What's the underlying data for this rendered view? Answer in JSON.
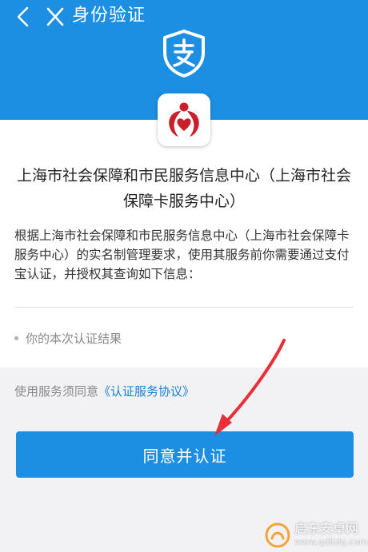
{
  "header": {
    "title": "身份验证",
    "back_icon": "chevron-left-icon",
    "close_icon": "close-icon",
    "badge_icon": "alipay-shield-icon",
    "background_color": "#1c8fe3"
  },
  "org": {
    "logo_icon": "heart-hands-logo",
    "name": "上海市社会保障和市民服务信息中心（上海市社会保障卡服务中心）",
    "description": "根据上海市社会保障和市民服务信息中心（上海市社会保障卡服务中心）的实名制管理要求，使用其服务前你需要通过支付宝认证，并授权其查询如下信息："
  },
  "permissions": [
    "你的本次认证结果"
  ],
  "agreement": {
    "prefix": "使用服务须同意",
    "link": "《认证服务协议》",
    "link_color": "#1a7fd6"
  },
  "primary_button": {
    "label": "同意并认证",
    "color": "#1c8fe3"
  },
  "overlay": {
    "arrow_color": "#e8303a"
  },
  "watermark": {
    "brand": "启东安卓网",
    "url": "www.qdltdq.com"
  }
}
